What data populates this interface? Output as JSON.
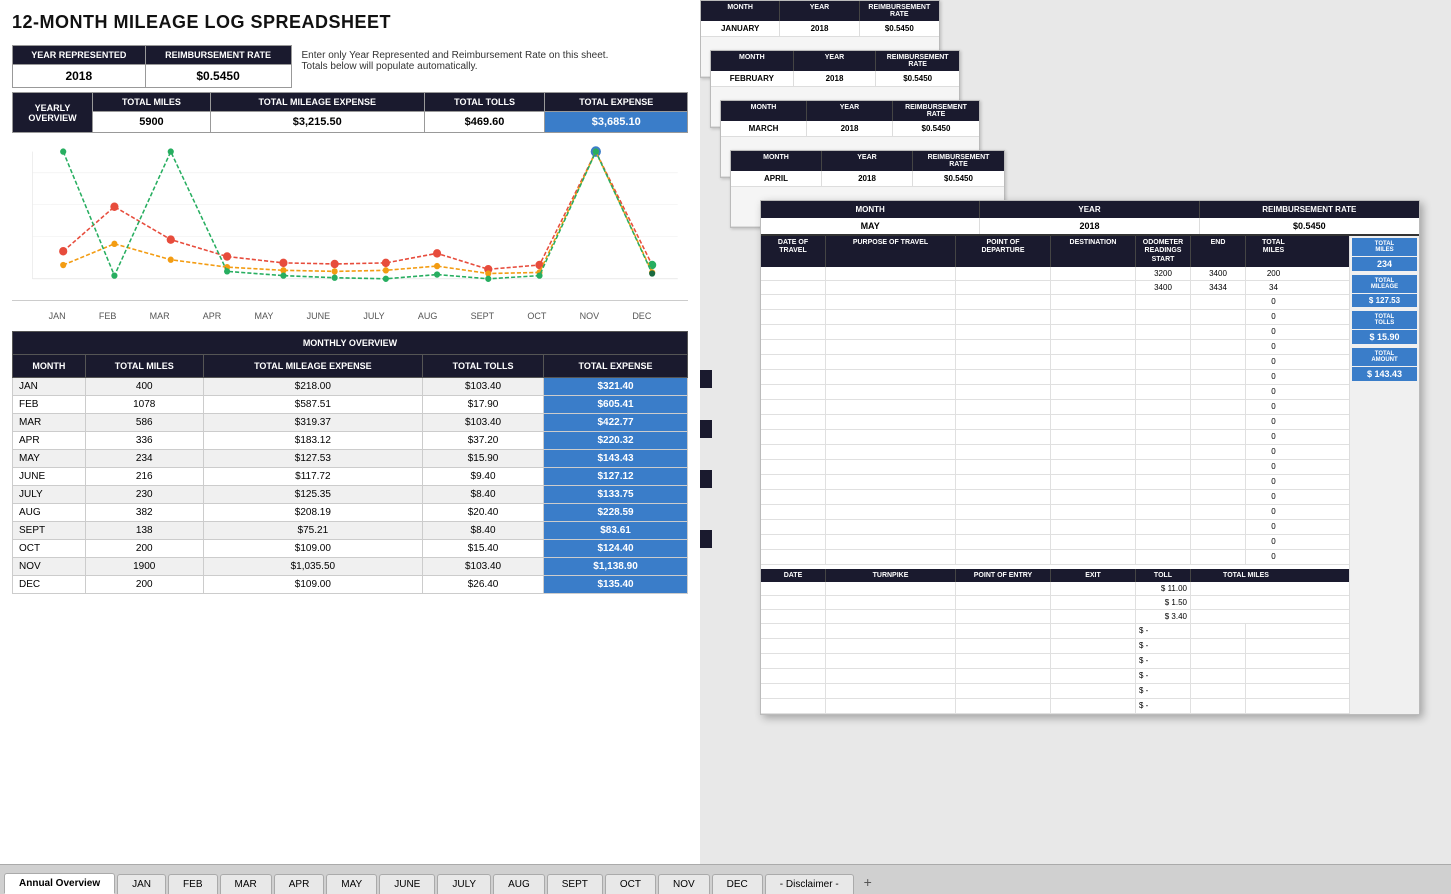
{
  "title": "12-MONTH MILEAGE LOG SPREADSHEET",
  "header": {
    "year_label": "YEAR REPRESENTED",
    "rate_label": "REIMBURSEMENT RATE",
    "year_value": "2018",
    "rate_value": "$0.5450",
    "instruction1": "Enter only Year Represented and Reimbursement Rate on this sheet.",
    "instruction2": "Totals below will populate automatically."
  },
  "yearly_overview": {
    "title": "YEARLY OVERVIEW",
    "col_miles": "TOTAL MILES",
    "col_expense": "TOTAL MILEAGE EXPENSE",
    "col_tolls": "TOTAL TOLLS",
    "col_total": "TOTAL EXPENSE",
    "miles": "5900",
    "expense": "$3,215.50",
    "tolls": "$469.60",
    "total": "$3,685.10"
  },
  "chart": {
    "months": [
      "JAN",
      "FEB",
      "MAR",
      "APR",
      "MAY",
      "JUNE",
      "JULY",
      "AUG",
      "SEPT",
      "OCT",
      "NOV",
      "DEC"
    ],
    "series": [
      {
        "name": "miles",
        "color": "#e74c3c",
        "values": [
          400,
          1078,
          586,
          336,
          234,
          216,
          230,
          382,
          138,
          200,
          1900,
          200
        ]
      },
      {
        "name": "expense",
        "color": "#f39c12",
        "values": [
          218,
          587,
          319,
          183,
          127,
          117,
          125,
          208,
          75,
          109,
          1035,
          109
        ]
      },
      {
        "name": "tolls",
        "color": "#27ae60",
        "values": [
          103,
          17,
          103,
          37,
          15,
          9,
          8,
          20,
          8,
          15,
          103,
          26
        ]
      }
    ]
  },
  "monthly_overview": {
    "title": "MONTHLY OVERVIEW",
    "headers": [
      "MONTH",
      "TOTAL MILES",
      "TOTAL MILEAGE EXPENSE",
      "TOTAL TOLLS",
      "TOTAL EXPENSE"
    ],
    "rows": [
      {
        "month": "JAN",
        "miles": "400",
        "expense": "$218.00",
        "tolls": "$103.40",
        "total": "$321.40"
      },
      {
        "month": "FEB",
        "miles": "1078",
        "expense": "$587.51",
        "tolls": "$17.90",
        "total": "$605.41"
      },
      {
        "month": "MAR",
        "miles": "586",
        "expense": "$319.37",
        "tolls": "$103.40",
        "total": "$422.77"
      },
      {
        "month": "APR",
        "miles": "336",
        "expense": "$183.12",
        "tolls": "$37.20",
        "total": "$220.32"
      },
      {
        "month": "MAY",
        "miles": "234",
        "expense": "$127.53",
        "tolls": "$15.90",
        "total": "$143.43"
      },
      {
        "month": "JUNE",
        "miles": "216",
        "expense": "$117.72",
        "tolls": "$9.40",
        "total": "$127.12"
      },
      {
        "month": "JULY",
        "miles": "230",
        "expense": "$125.35",
        "tolls": "$8.40",
        "total": "$133.75"
      },
      {
        "month": "AUG",
        "miles": "382",
        "expense": "$208.19",
        "tolls": "$20.40",
        "total": "$228.59"
      },
      {
        "month": "SEPT",
        "miles": "138",
        "expense": "$75.21",
        "tolls": "$8.40",
        "total": "$83.61"
      },
      {
        "month": "OCT",
        "miles": "200",
        "expense": "$109.00",
        "tolls": "$15.40",
        "total": "$124.40"
      },
      {
        "month": "NOV",
        "miles": "1900",
        "expense": "$1,035.50",
        "tolls": "$103.40",
        "total": "$1,138.90"
      },
      {
        "month": "DEC",
        "miles": "200",
        "expense": "$109.00",
        "tolls": "$26.40",
        "total": "$135.40"
      }
    ]
  },
  "tabs": [
    "Annual Overview",
    "JAN",
    "FEB",
    "MAR",
    "APR",
    "MAY",
    "JUNE",
    "JULY",
    "AUG",
    "SEPT",
    "OCT",
    "NOV",
    "DEC",
    "- Disclaimer -"
  ],
  "active_tab": "Annual Overview",
  "sheets": {
    "january": {
      "month": "JANUARY",
      "year": "2018",
      "rate": "$0.5450"
    },
    "february": {
      "month": "FEBRUARY",
      "year": "2018",
      "rate": "$0.5450"
    },
    "march": {
      "month": "MARCH",
      "year": "2018",
      "rate": "$0.5450"
    },
    "april": {
      "month": "APRIL",
      "year": "2018",
      "rate": "$0.5450"
    },
    "may": {
      "month": "MAY",
      "year": "2018",
      "rate": "$0.5450",
      "travel_headers": [
        "DATE OF TRAVEL",
        "PURPOSE OF TRAVEL",
        "POINT OF DEPARTURE",
        "DESTINATION",
        "ODOMETER READINGS",
        "",
        "TOTAL MILES"
      ],
      "odometer_headers": [
        "START",
        "END"
      ],
      "travel_rows": [
        {
          "start": "3200",
          "end": "3400",
          "total": "200"
        },
        {
          "start": "3400",
          "end": "3434",
          "total": "34"
        }
      ],
      "toll_headers": [
        "DATE",
        "TURNPIKE",
        "POINT OF ENTRY",
        "EXIT",
        "TOLL",
        "TOTAL MILES"
      ],
      "toll_rows": [
        {
          "toll": "$ 11.00"
        },
        {
          "toll": "$ 1.50"
        },
        {
          "toll": "$ 3.40"
        },
        {
          "toll": "$  -"
        },
        {
          "toll": "$  -"
        },
        {
          "toll": "$  -"
        },
        {
          "toll": "$  -"
        },
        {
          "toll": "$  -"
        },
        {
          "toll": "$  -"
        }
      ],
      "total_miles": "234",
      "total_mileage": "$ 127.53",
      "total_tolls": "$ 15.90",
      "total_amount": "$ 143.43"
    }
  }
}
